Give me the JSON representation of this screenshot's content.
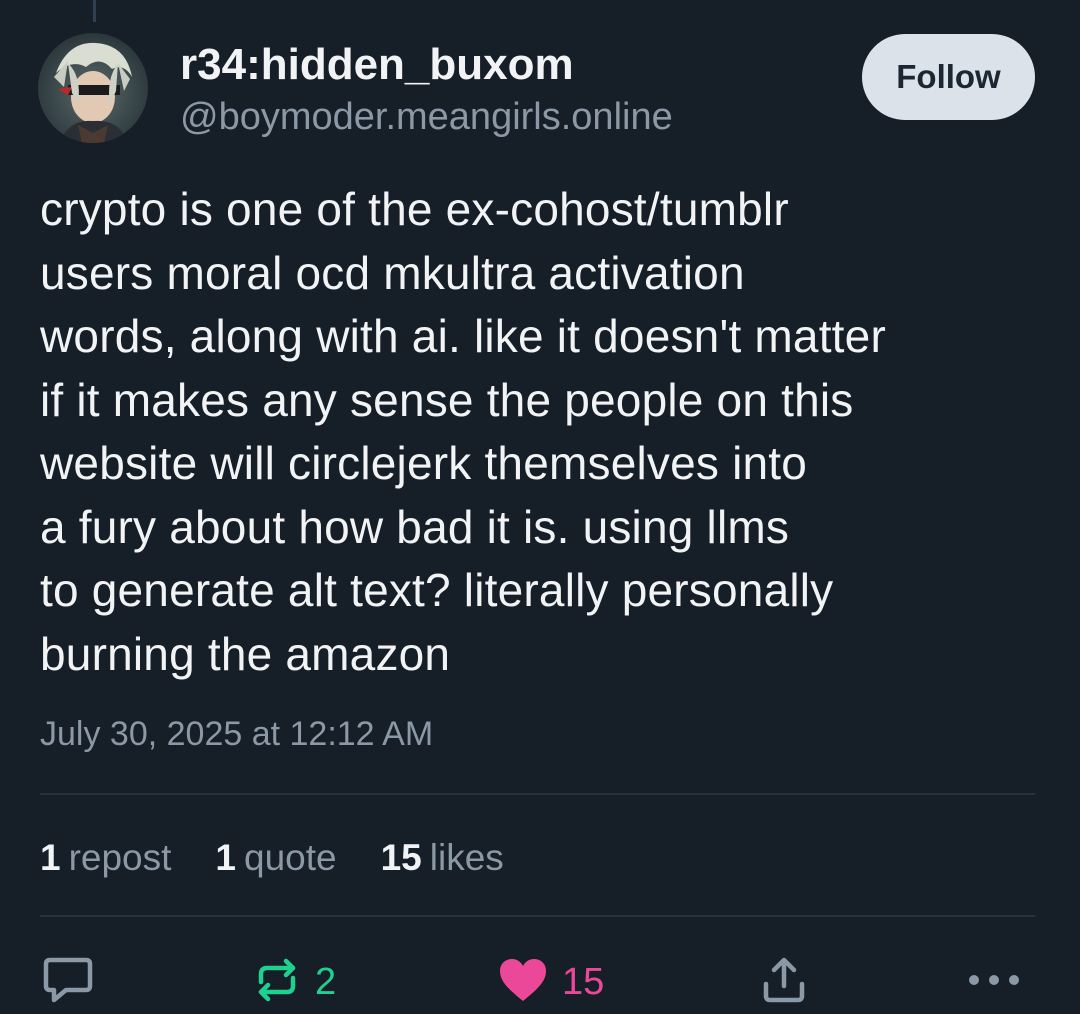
{
  "post": {
    "author": {
      "display_name": "r34:hidden_buxom",
      "handle": "@boymoder.meangirls.online"
    },
    "follow_label": "Follow",
    "text": "crypto is one of the ex-cohost/tumblr\nusers moral ocd mkultra activation\nwords, along with ai. like it doesn't matter\nif it makes any sense the people on this\nwebsite will circlejerk themselves into\na fury about how bad it is. using llms\nto generate alt text? literally personally\nburning the amazon",
    "timestamp": "July 30, 2025 at 12:12 AM",
    "stats": {
      "reposts_count": "1",
      "reposts_label": "repost",
      "quotes_count": "1",
      "quotes_label": "quote",
      "likes_count": "15",
      "likes_label": "likes"
    },
    "actions": {
      "reply_icon": "reply-icon",
      "repost_icon": "repost-icon",
      "repost_count": "2",
      "like_icon": "heart-icon",
      "like_count": "15",
      "share_icon": "share-icon",
      "more_icon": "more-options-icon"
    }
  },
  "colors": {
    "background": "#161e27",
    "text": "#f1f3f5",
    "muted": "#8b98a5",
    "follow_bg": "#dce2ea",
    "repost_active": "#1fd18e",
    "like_active": "#ec4899"
  }
}
